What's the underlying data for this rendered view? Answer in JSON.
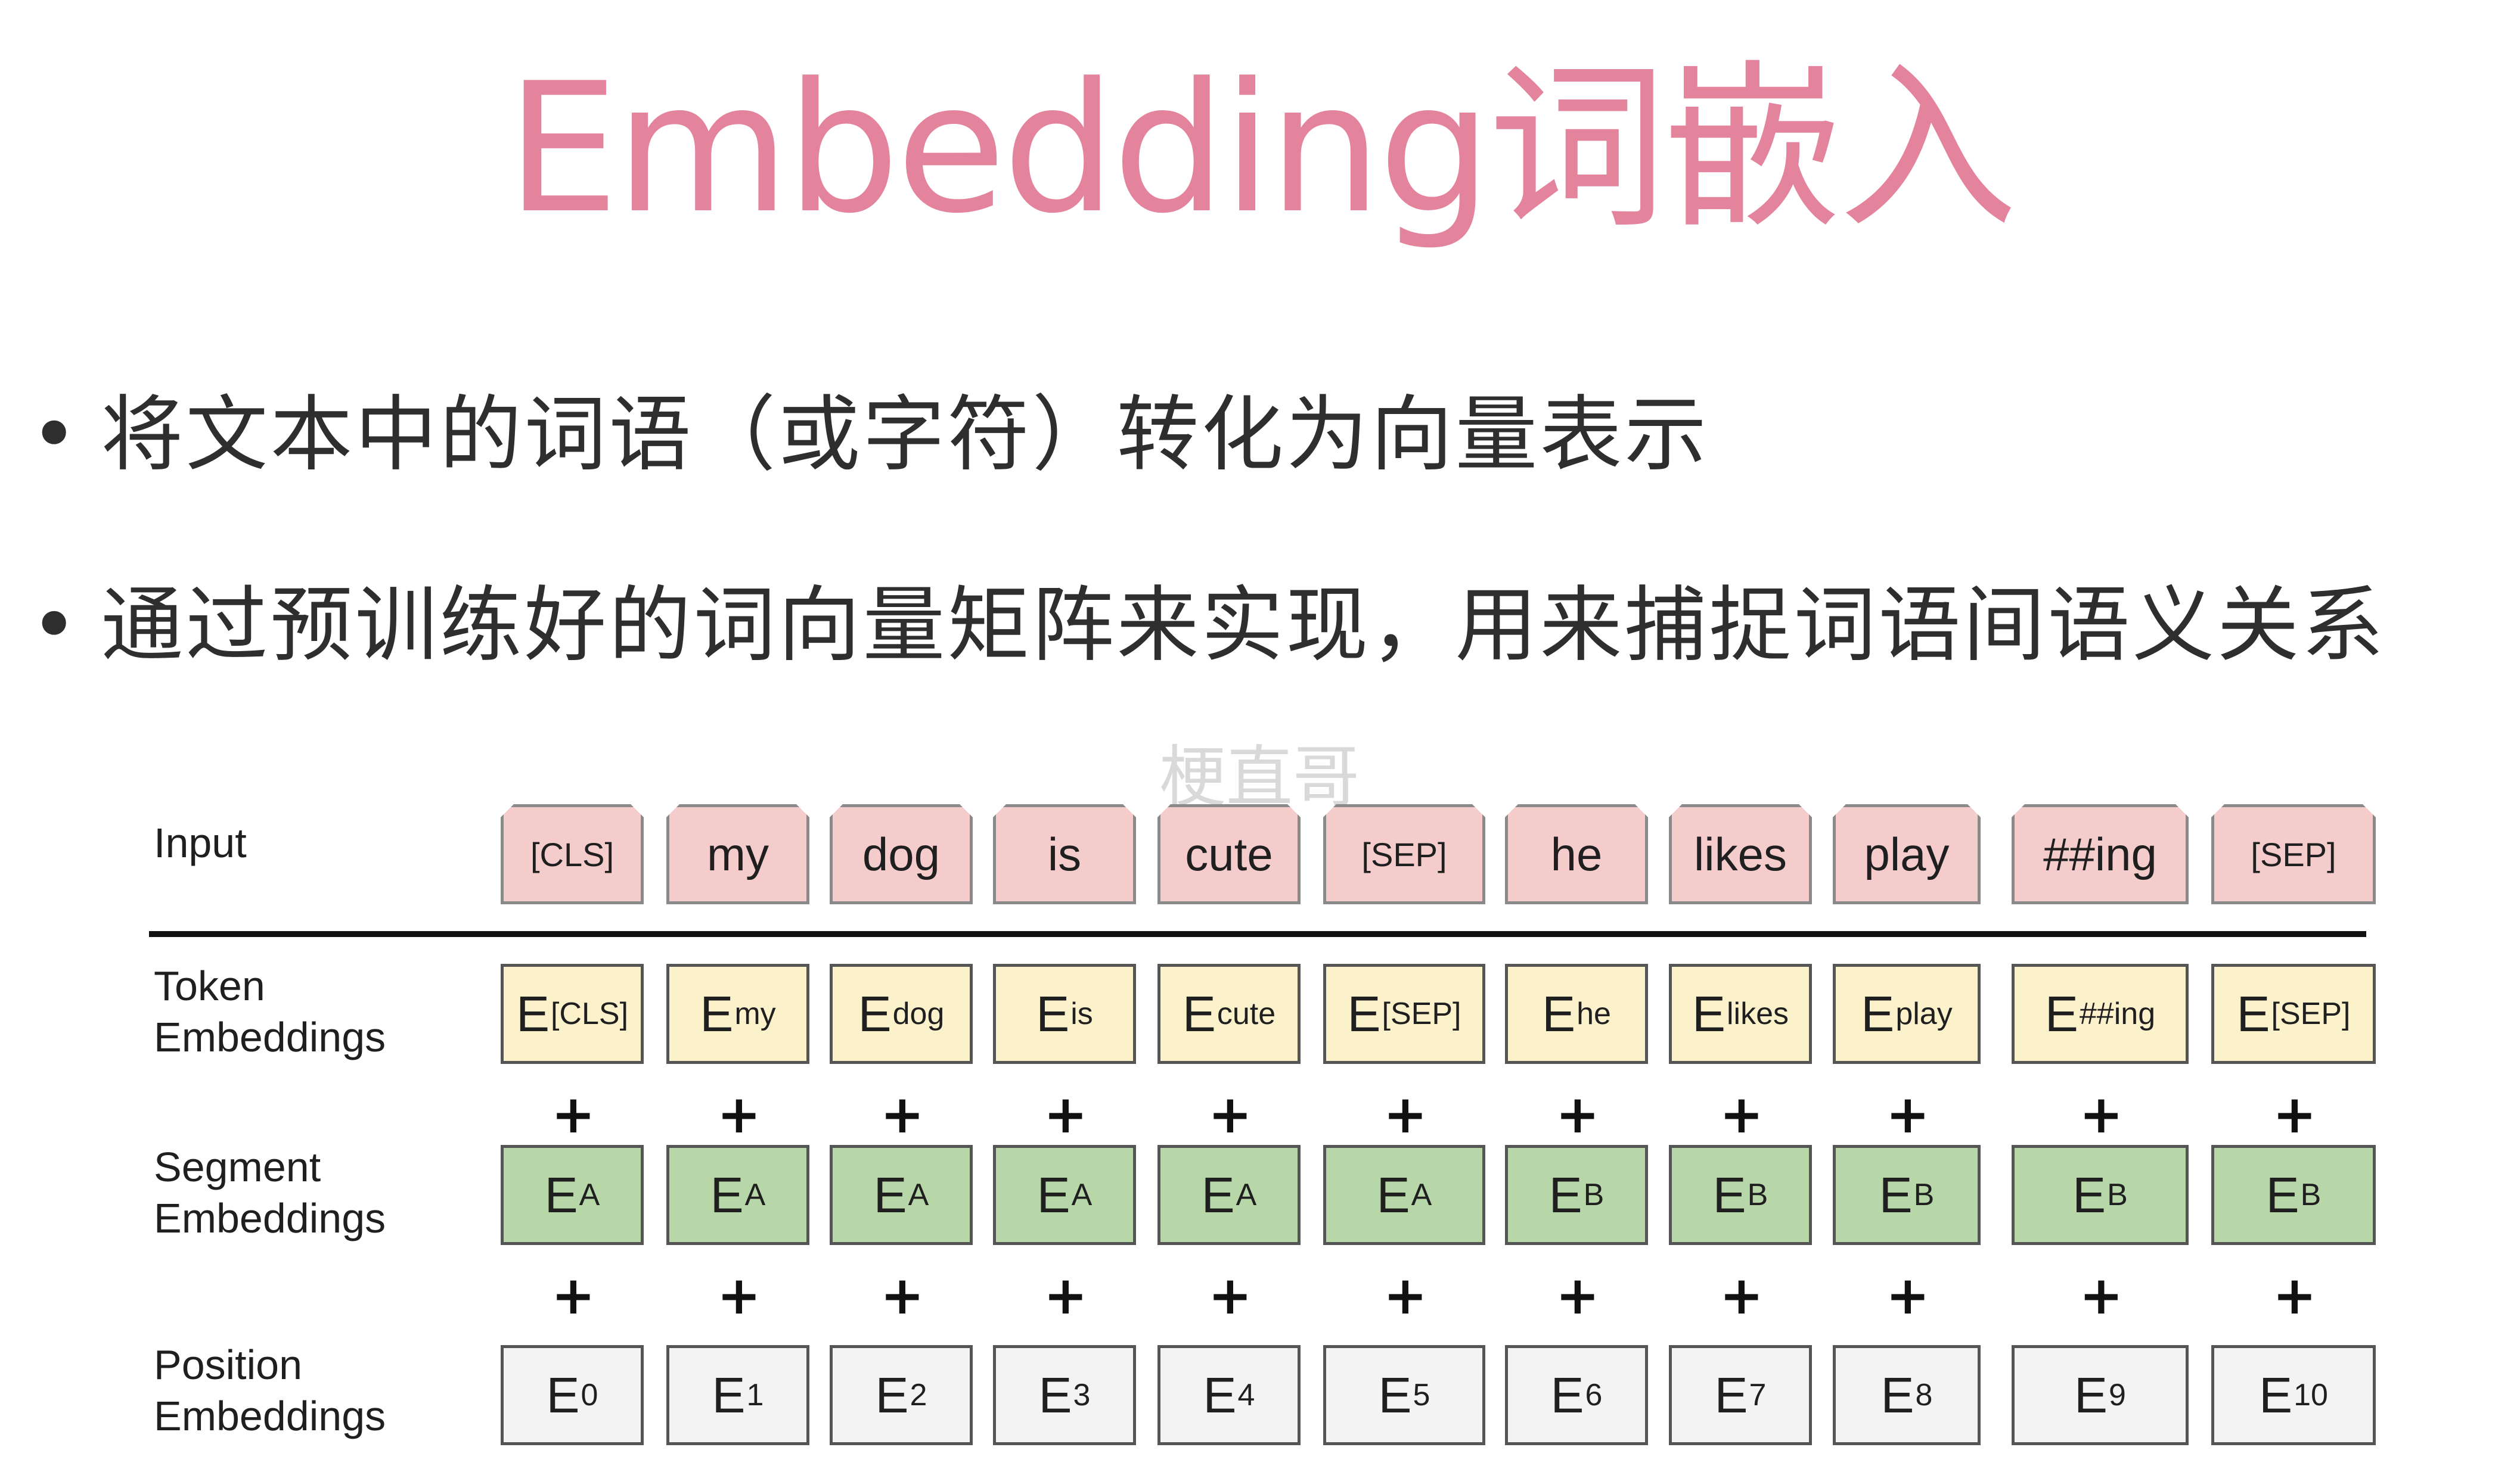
{
  "title": "Embedding词嵌入",
  "bullets": [
    "将文本中的词语（或字符）转化为向量表示",
    "通过预训练好的词向量矩阵来实现，用来捕捉词语间语义关系"
  ],
  "bullet_symbol": "•",
  "watermark": "梗直哥",
  "plus_symbol": "+",
  "rows": {
    "input": "Input",
    "token": [
      "Token",
      "Embeddings"
    ],
    "segment": [
      "Segment",
      "Embeddings"
    ],
    "position": [
      "Position",
      "Embeddings"
    ]
  },
  "input_tokens": [
    "[CLS]",
    "my",
    "dog",
    "is",
    "cute",
    "[SEP]",
    "he",
    "likes",
    "play",
    "##ing",
    "[SEP]"
  ],
  "embedding_letter": "E",
  "token_subscripts": [
    "[CLS]",
    "my",
    "dog",
    "is",
    "cute",
    "[SEP]",
    "he",
    "likes",
    "play",
    "##ing",
    "[SEP]"
  ],
  "segment_subscripts": [
    "A",
    "A",
    "A",
    "A",
    "A",
    "A",
    "B",
    "B",
    "B",
    "B",
    "B"
  ],
  "position_subscripts": [
    "0",
    "1",
    "2",
    "3",
    "4",
    "5",
    "6",
    "7",
    "8",
    "9",
    "10"
  ],
  "colors": {
    "title": "#e4849c",
    "input_token": "#f4cccc",
    "token_embedding": "#fbf2cc",
    "segment_embedding": "#b7d7a8",
    "position_embedding": "#f3f3f3"
  }
}
